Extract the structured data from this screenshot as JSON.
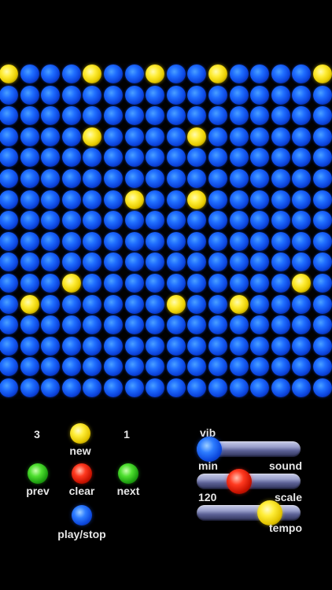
{
  "grid": {
    "rows": 16,
    "cols": 16,
    "on_color": "#ffe800",
    "off_color": "#1f6eff",
    "active_cells": [
      [
        0,
        0
      ],
      [
        0,
        4
      ],
      [
        0,
        7
      ],
      [
        0,
        10
      ],
      [
        0,
        15
      ],
      [
        3,
        4
      ],
      [
        3,
        9
      ],
      [
        6,
        6
      ],
      [
        6,
        9
      ],
      [
        10,
        3
      ],
      [
        10,
        14
      ],
      [
        11,
        1
      ],
      [
        11,
        8
      ],
      [
        11,
        11
      ]
    ]
  },
  "controls": {
    "prev_count": "3",
    "next_count": "1",
    "new_label": "new",
    "prev_label": "prev",
    "clear_label": "clear",
    "next_label": "next",
    "playstop_label": "play/stop"
  },
  "sliders": {
    "vib": {
      "top_label": "vib",
      "bottom_label": "sound",
      "value": 0.0,
      "knob_color": "blue"
    },
    "scale": {
      "top_label": "min",
      "bottom_label": "scale",
      "value": 0.38,
      "knob_color": "red"
    },
    "tempo": {
      "top_label": "120",
      "bottom_label": "tempo",
      "value": 0.77,
      "knob_color": "yellow"
    }
  }
}
